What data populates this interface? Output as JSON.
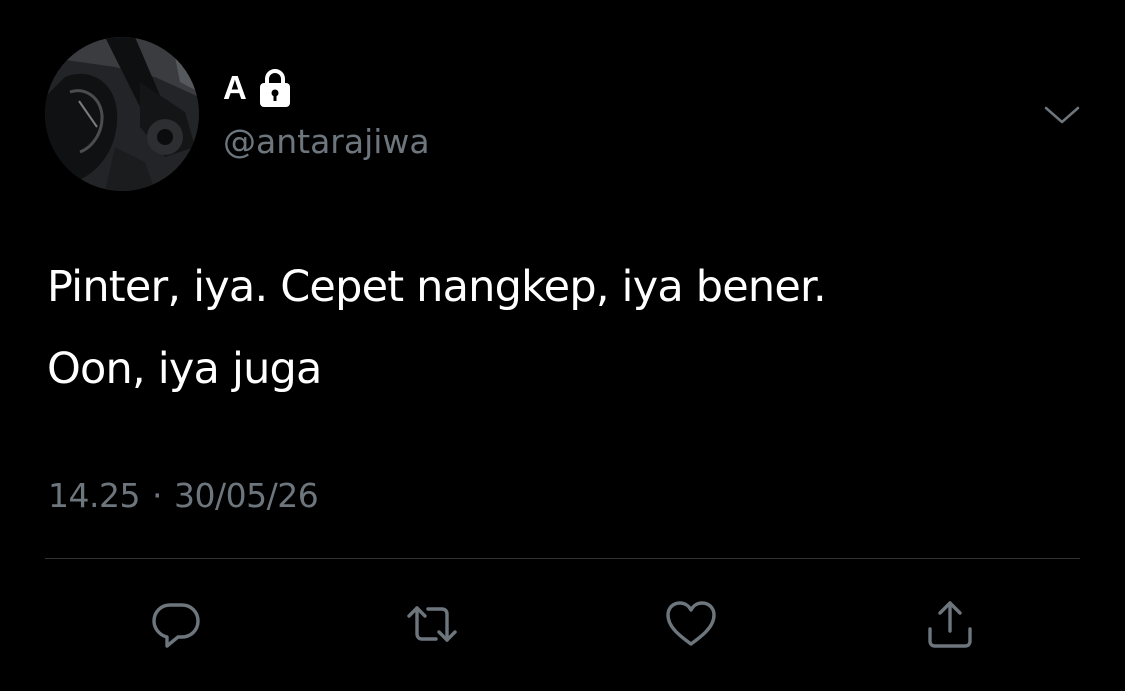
{
  "tweet": {
    "author": {
      "display_name": "A",
      "handle": "@antarajiwa",
      "protected_icon": "lock-icon",
      "avatar": "motorcycle-photo"
    },
    "text_lines": [
      "Pinter, iya. Cepet nangkep, iya bener.",
      "Oon, iya juga"
    ],
    "time": "14.25",
    "separator": "·",
    "date": "30/05/26",
    "more_icon": "chevron-down-icon"
  },
  "actions": [
    {
      "name": "reply",
      "icon": "reply-icon"
    },
    {
      "name": "retweet",
      "icon": "retweet-icon"
    },
    {
      "name": "like",
      "icon": "heart-icon"
    },
    {
      "name": "share",
      "icon": "share-icon"
    }
  ],
  "colors": {
    "background": "#000000",
    "text_primary": "#ffffff",
    "text_secondary": "#6e767d",
    "divider": "#2f3336",
    "icon": "#6e767d"
  }
}
